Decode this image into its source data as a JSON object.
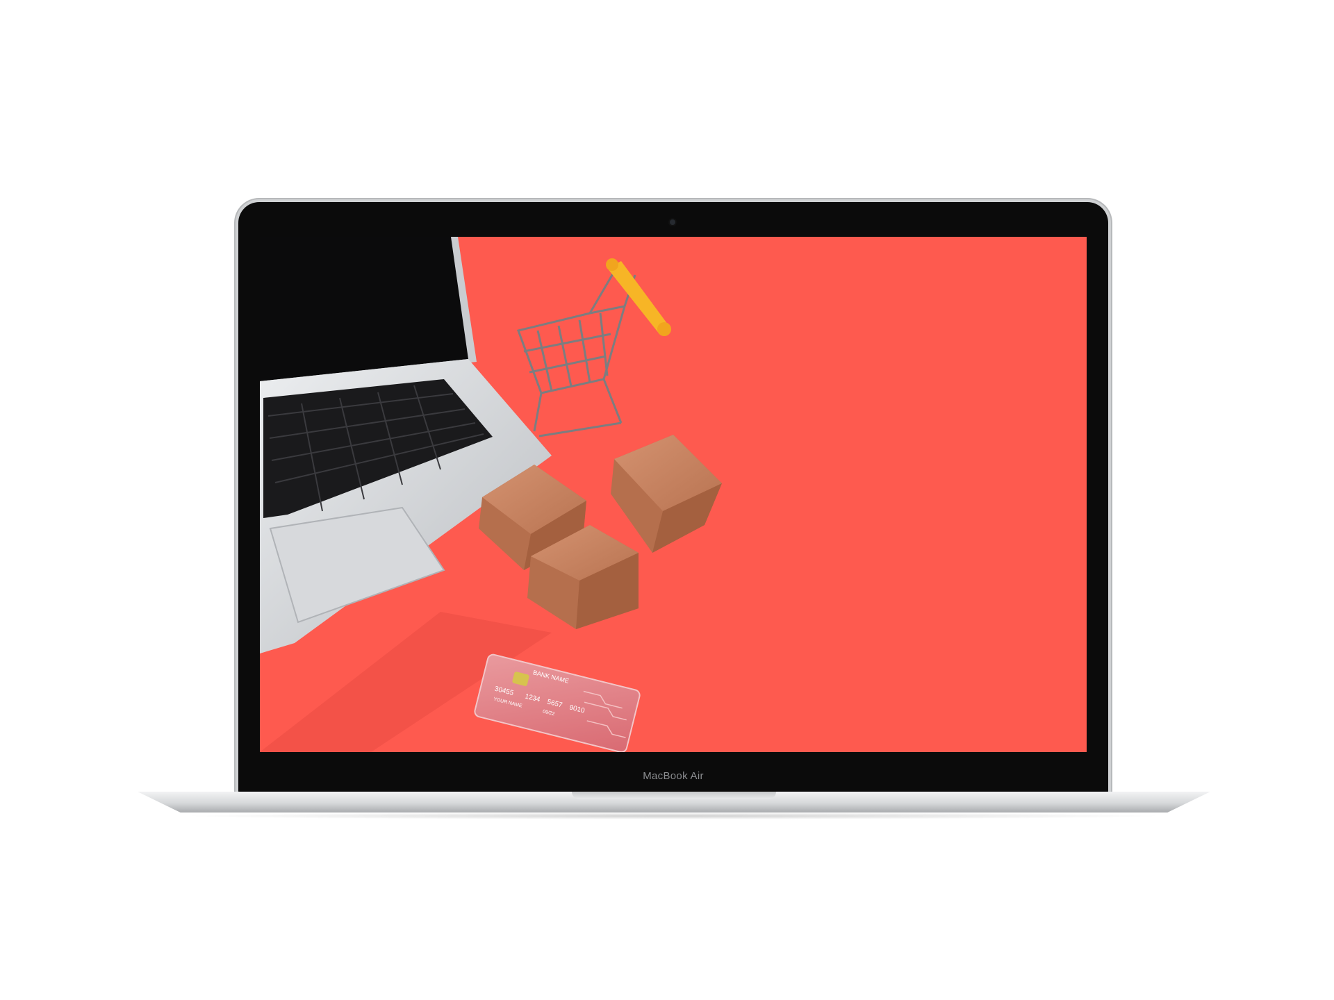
{
  "device": {
    "brand_label": "MacBook Air"
  },
  "credit_card": {
    "bank": "BANK NAME",
    "number_groups": [
      "30455",
      "1234",
      "5657",
      "9010"
    ],
    "holder": "YOUR NAME",
    "expiry": "09/22"
  },
  "colors": {
    "background": "#fe5a4f",
    "box": "#bf7a57",
    "cart_handle": "#f7b526"
  }
}
